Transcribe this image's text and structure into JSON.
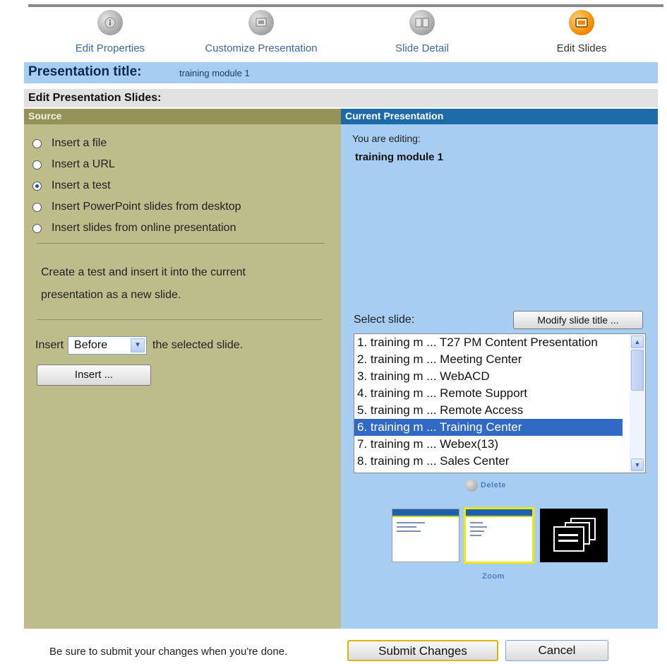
{
  "steps": [
    {
      "label": "Edit Properties",
      "icon": "edit-properties-icon"
    },
    {
      "label": "Customize Presentation",
      "icon": "customize-presentation-icon"
    },
    {
      "label": "Slide Detail",
      "icon": "slide-detail-icon"
    },
    {
      "label": "Edit Slides",
      "icon": "edit-slides-icon",
      "active": true
    }
  ],
  "title_bar": {
    "key": "Presentation title:",
    "value": "training module 1"
  },
  "sub_header": "Edit Presentation Slides:",
  "source": {
    "header": "Source",
    "options": [
      {
        "label": "Insert a file",
        "checked": false
      },
      {
        "label": "Insert a URL",
        "checked": false
      },
      {
        "label": "Insert a test",
        "checked": true
      },
      {
        "label": "Insert PowerPoint slides from desktop",
        "checked": false
      },
      {
        "label": "Insert slides from online presentation",
        "checked": false
      }
    ],
    "description": "Create a test and insert it into the current presentation as a new slide.",
    "insert_prefix": "Insert",
    "position_value": "Before",
    "insert_suffix": "the selected slide.",
    "insert_button": "Insert ..."
  },
  "current": {
    "header": "Current Presentation",
    "editing_label": "You are editing:",
    "editing_value": "training module 1",
    "select_label": "Select slide:",
    "modify_button": "Modify slide title ...",
    "slides": [
      "1. training m ... T27 PM Content Presentation",
      "2. training m ... Meeting Center",
      "3. training m ... WebACD",
      "4. training m ... Remote Support",
      "5. training m ... Remote Access",
      "6. training m ... Training Center",
      "7. training m ... Webex(13)",
      "8. training m ... Sales Center"
    ],
    "selected_index": 5,
    "delete_label": "Delete",
    "zoom_label": "Zoom"
  },
  "footer": {
    "text": "Be sure to submit your changes when you're done.",
    "submit": "Submit Changes",
    "cancel": "Cancel"
  },
  "colors": {
    "left_panel": "#bdbc8b",
    "left_header": "#939257",
    "right_panel": "#a7cdf2",
    "right_header": "#1c6aa8",
    "selected_row": "#316ac5",
    "active_step": "#f28a00"
  }
}
